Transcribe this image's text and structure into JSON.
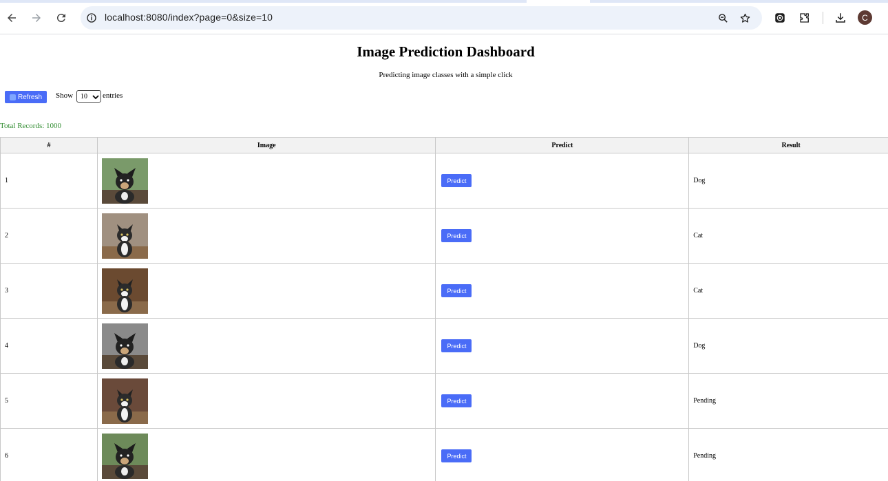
{
  "browser": {
    "url": "localhost:8080/index?page=0&size=10",
    "profile_initial": "C"
  },
  "page": {
    "title": "Image Prediction Dashboard",
    "subtitle": "Predicting image classes with a simple click",
    "refresh_label": "Refresh",
    "show_label": "Show",
    "page_size": "10",
    "entries_label": "entries",
    "total_records": "Total Records: 1000"
  },
  "table": {
    "headers": [
      "#",
      "Image",
      "Predict",
      "Result"
    ],
    "predict_label": "Predict",
    "rows": [
      {
        "index": "1",
        "result": "Dog",
        "thumb": "dog-photo"
      },
      {
        "index": "2",
        "result": "Cat",
        "thumb": "cat-photo"
      },
      {
        "index": "3",
        "result": "Cat",
        "thumb": "cat-photo"
      },
      {
        "index": "4",
        "result": "Dog",
        "thumb": "dog-photo"
      },
      {
        "index": "5",
        "result": "Pending",
        "thumb": "cat-photo"
      },
      {
        "index": "6",
        "result": "Pending",
        "thumb": "dog-photo"
      }
    ]
  },
  "colors": {
    "accent": "#4a6cf7",
    "total_text": "#2e8b2e",
    "header_bg": "#f2f2f2"
  }
}
